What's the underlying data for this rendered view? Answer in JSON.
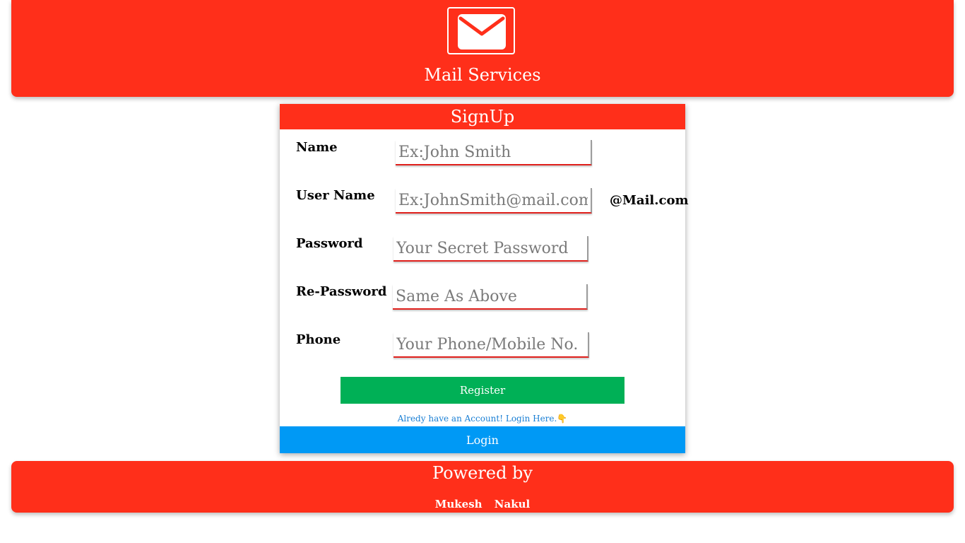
{
  "header": {
    "logo_icon": "envelope-icon",
    "title": "Mail Services"
  },
  "signup": {
    "title": "SignUp",
    "fields": [
      {
        "label": "Name",
        "placeholder": "Ex:John Smith"
      },
      {
        "label": "User Name",
        "placeholder": "Ex:JohnSmith@mail.com",
        "suffix": "@Mail.com"
      },
      {
        "label": "Password",
        "placeholder": "Your Secret Password"
      },
      {
        "label": "Re-Password",
        "placeholder": "Same As Above"
      },
      {
        "label": "Phone",
        "placeholder": "Your Phone/Mobile No."
      }
    ],
    "register_label": "Register",
    "login_link": "Alredy have an Account! Login Here.👇",
    "login_label": "Login"
  },
  "footer": {
    "title": "Powered by",
    "authors": [
      "Mukesh",
      "Nakul"
    ]
  },
  "colors": {
    "brand_red": "#ff2f1a",
    "register_green": "#00b056",
    "login_blue": "#0099f5",
    "link_blue": "#1a7fd4"
  }
}
